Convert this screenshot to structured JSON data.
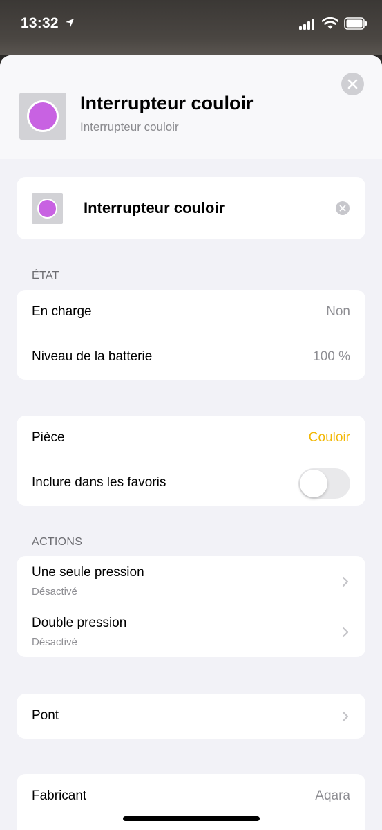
{
  "status_bar": {
    "time": "13:32"
  },
  "header": {
    "title": "Interrupteur couloir",
    "subtitle": "Interrupteur couloir",
    "accessory_color": "#c862e2"
  },
  "name_card": {
    "name": "Interrupteur couloir"
  },
  "sections": {
    "etat": {
      "title": "ÉTAT",
      "rows": [
        {
          "label": "En charge",
          "value": "Non"
        },
        {
          "label": "Niveau de la batterie",
          "value": "100 %"
        }
      ]
    },
    "room": {
      "piece_label": "Pièce",
      "piece_value": "Couloir",
      "favorites_label": "Inclure dans les favoris",
      "favorites_on": false
    },
    "actions": {
      "title": "ACTIONS",
      "rows": [
        {
          "label": "Une seule pression",
          "sub": "Désactivé"
        },
        {
          "label": "Double pression",
          "sub": "Désactivé"
        }
      ]
    },
    "bridge": {
      "label": "Pont"
    },
    "info": {
      "rows": [
        {
          "label": "Fabricant",
          "value": "Aqara"
        }
      ]
    }
  },
  "colors": {
    "accent": "#f2b705",
    "background": "#f2f2f7"
  }
}
